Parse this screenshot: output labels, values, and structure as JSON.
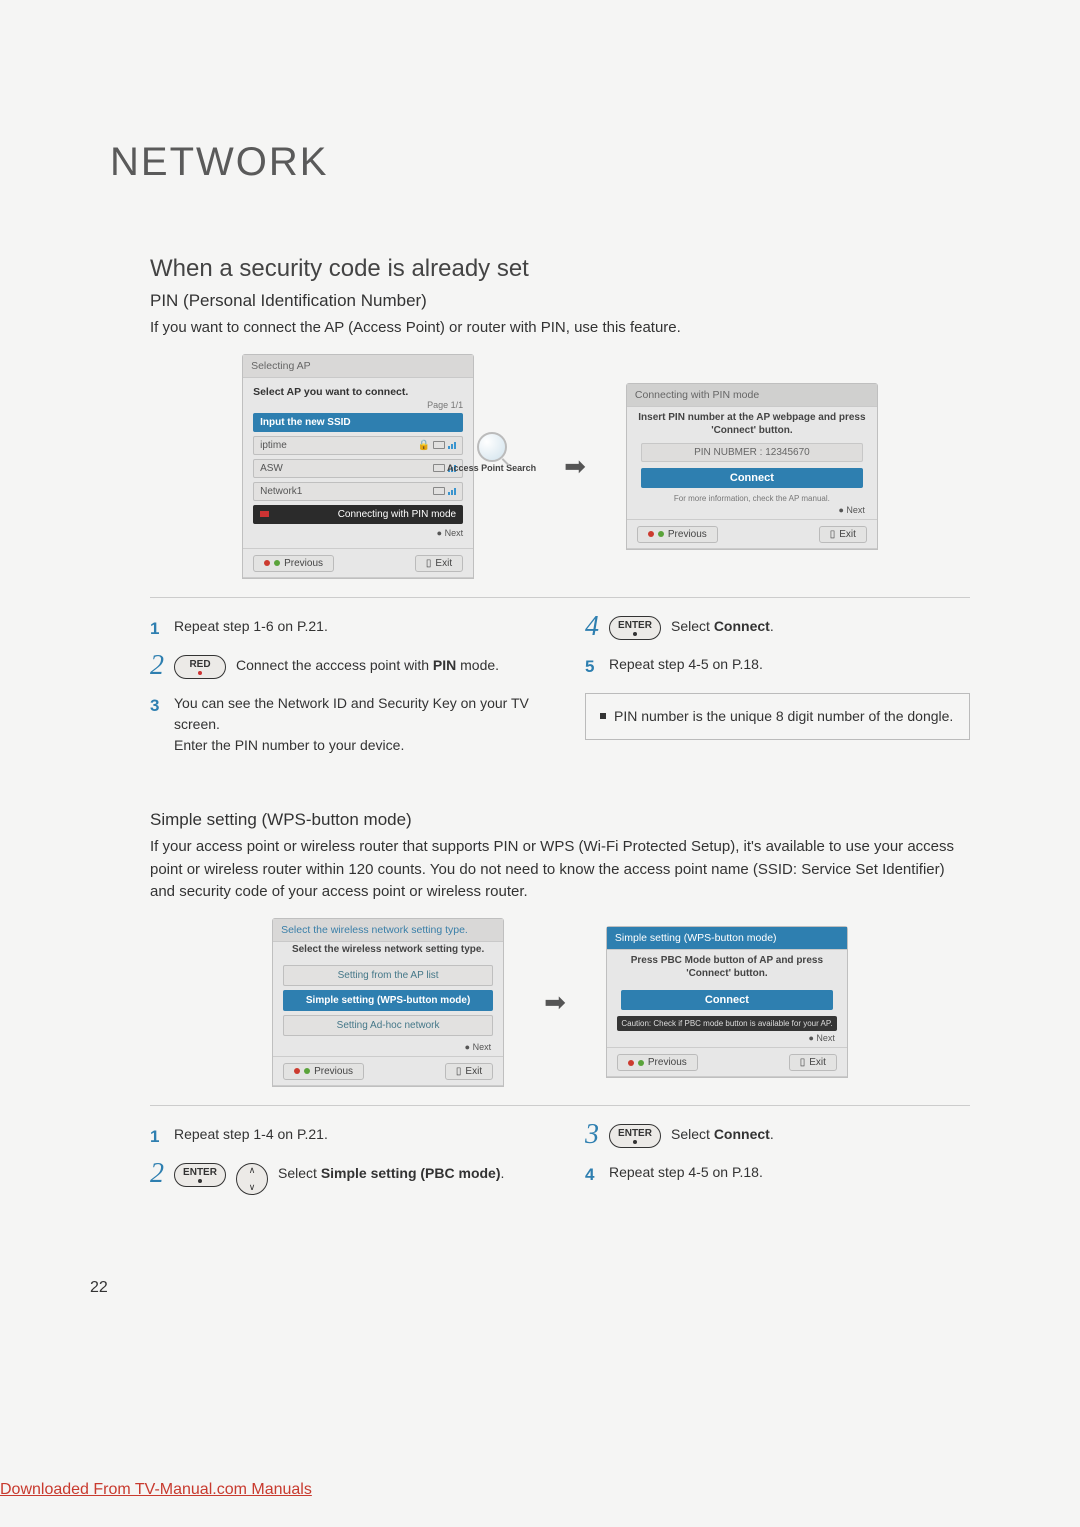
{
  "page": {
    "title": "NETWORK",
    "h2a": "When a security code is already set",
    "h3a": "PIN (Personal Identification Number)",
    "intro_a": "If you want to connect the AP (Access Point) or router with PIN, use this feature.",
    "h3b": "Simple setting (WPS-button mode)",
    "intro_b": "If your access point or wireless router that supports PIN or WPS (Wi-Fi Protected Setup), it's available to use your access point or wireless router within 120 counts. You do not need to know the access point name (SSID: Service Set Identifier) and security code of your access point or wireless router.",
    "page_number": "22",
    "footer_link": "Downloaded From TV-Manual.com Manuals"
  },
  "osd_ap": {
    "title": "Selecting AP",
    "subhead": "Select AP you want to connect.",
    "page_ind": "Page 1/1",
    "rows": {
      "input_ssid": "Input the new SSID",
      "r1": "iptime",
      "r2": "ASW",
      "r3": "Network1",
      "pin_mode": "Connecting with PIN mode"
    },
    "search_label": "Access Point Search",
    "next": "Next",
    "prev": "Previous",
    "exit": "Exit"
  },
  "osd_pin": {
    "title": "Connecting with PIN mode",
    "header": "Insert PIN number at the AP webpage and press 'Connect' button.",
    "pin_label": "PIN NUBMER : 12345670",
    "connect": "Connect",
    "manual": "For more information, check the AP manual.",
    "next": "Next",
    "prev": "Previous",
    "exit": "Exit"
  },
  "osd_wps_select": {
    "title": "Select the wireless network setting type.",
    "head": "Select the wireless network setting type.",
    "opt1": "Setting from the AP list",
    "opt2": "Simple setting (WPS-button mode)",
    "opt3": "Setting Ad-hoc network",
    "next": "Next",
    "prev": "Previous",
    "exit": "Exit"
  },
  "osd_wps_run": {
    "title": "Simple setting (WPS-button mode)",
    "head": "Press PBC Mode button of AP and press 'Connect' button.",
    "connect": "Connect",
    "caution": "Caution: Check if PBC mode button is available for your AP.",
    "next": "Next",
    "prev": "Previous",
    "exit": "Exit"
  },
  "steps_a": {
    "s1": "Repeat step 1-6 on P.21.",
    "s2_key": "RED",
    "s2": "Connect the acccess point with PIN mode.",
    "s2_strong": "PIN",
    "s3a": "You can see the Network ID and Security Key on your TV screen.",
    "s3b": "Enter the PIN number to your device.",
    "s4_key": "ENTER",
    "s4": "Select Connect.",
    "s4_strong": "Connect",
    "s5": "Repeat step 4-5 on P.18.",
    "note": "PIN number is the unique 8 digit number of the dongle."
  },
  "steps_b": {
    "s1": "Repeat step 1-4 on P.21.",
    "s2_key": "ENTER",
    "s2": "Select Simple setting (PBC mode).",
    "s2_strong": "Simple setting (PBC mode)",
    "s3_key": "ENTER",
    "s3": "Select Connect.",
    "s3_strong": "Connect",
    "s4": "Repeat step 4-5 on P.18."
  }
}
